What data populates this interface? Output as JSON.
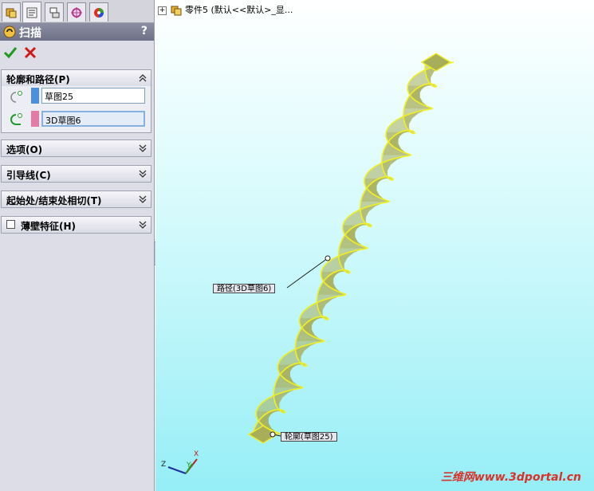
{
  "feature": {
    "title": "扫描",
    "help": "?"
  },
  "tabs": [
    {
      "icon": "feature-manager-icon"
    },
    {
      "icon": "property-manager-icon"
    },
    {
      "icon": "configuration-manager-icon"
    },
    {
      "icon": "dimxpert-icon"
    },
    {
      "icon": "display-manager-icon"
    }
  ],
  "groups": {
    "profile_path": {
      "label": "轮廓和路径(P)",
      "profile_value": "草图25",
      "path_value": "3D草图6"
    },
    "options": {
      "label": "选项(O)"
    },
    "guides": {
      "label": "引导线(C)"
    },
    "tangency": {
      "label": "起始处/结束处相切(T)"
    },
    "thin": {
      "label": "薄壁特征(H)",
      "checked": false
    }
  },
  "tree": {
    "label": "零件5 (默认<<默认>_显..."
  },
  "callouts": {
    "path": "路径(3D草图6)",
    "profile": "轮廓(草图25)"
  },
  "triad": {
    "x": "X",
    "y": "Y",
    "z": "Z"
  },
  "watermark": "三维网www.3dportal.cn",
  "colors": {
    "profile_swatch": "#4a90e0",
    "path_swatch": "#e67aa6",
    "preview_fill": "#a8ad5a",
    "preview_edge": "#f0f020"
  }
}
